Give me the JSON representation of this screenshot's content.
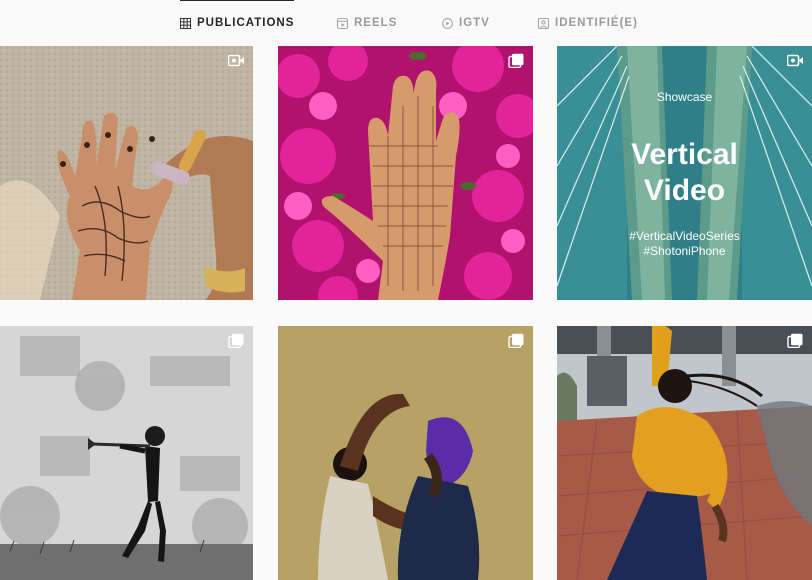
{
  "tabs": [
    {
      "label": "PUBLICATIONS",
      "icon": "grid-icon",
      "active": true
    },
    {
      "label": "REELS",
      "icon": "reels-icon",
      "active": false
    },
    {
      "label": "IGTV",
      "icon": "igtv-icon",
      "active": false
    },
    {
      "label": "IDENTIFIÉ(E)",
      "icon": "tagged-icon",
      "active": false
    }
  ],
  "posts": [
    {
      "description": "henna-hand-on-stone",
      "badge": "video-icon"
    },
    {
      "description": "henna-hand-pink-flowers",
      "badge": "carousel-icon"
    },
    {
      "description": "vertical-video-bridge",
      "badge": "video-icon",
      "overlay": {
        "showcase": "Showcase",
        "title_line1": "Vertical",
        "title_line2": "Video",
        "tag1": "#VerticalVideoSeries",
        "tag2": "#ShotoniPhone"
      }
    },
    {
      "description": "trumpet-player-bw",
      "badge": "carousel-icon"
    },
    {
      "description": "two-dancers-olive",
      "badge": "carousel-icon"
    },
    {
      "description": "dancer-yellow-sweater-bridge",
      "badge": "carousel-icon"
    }
  ],
  "colors": {
    "active_tab": "#262626",
    "inactive_tab": "#9a9a9a",
    "background": "#fafafa"
  }
}
